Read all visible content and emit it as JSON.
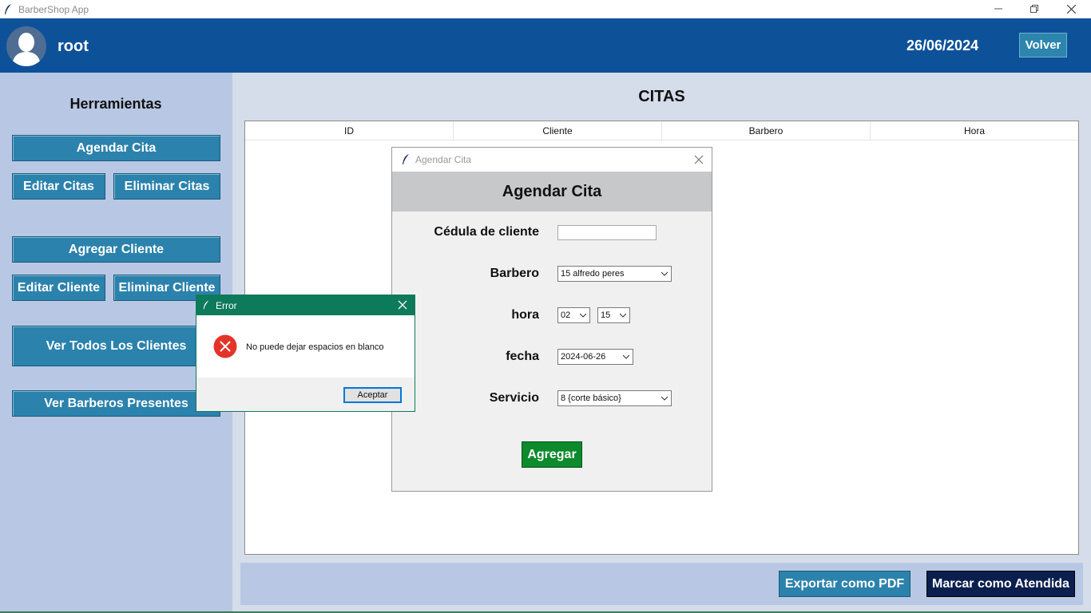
{
  "window": {
    "title": "BarberShop App"
  },
  "header": {
    "username": "root",
    "date": "26/06/2024",
    "back_label": "Volver"
  },
  "sidebar": {
    "title": "Herramientas",
    "buttons": {
      "agendar_cita": "Agendar Cita",
      "editar_citas": "Editar Citas",
      "eliminar_citas": "Eliminar Citas",
      "agregar_cliente": "Agregar Cliente",
      "editar_cliente": "Editar Cliente",
      "eliminar_cliente": "Eliminar Cliente",
      "ver_clientes": "Ver Todos Los Clientes",
      "ver_barberos": "Ver Barberos Presentes"
    }
  },
  "main": {
    "title": "CITAS",
    "columns": [
      "ID",
      "Cliente",
      "Barbero",
      "Hora"
    ]
  },
  "bottom": {
    "export_label": "Exportar como PDF",
    "mark_label": "Marcar como Atendida"
  },
  "agendar_dialog": {
    "window_title": "Agendar Cita",
    "heading": "Agendar Cita",
    "labels": {
      "cedula": "Cédula de cliente",
      "barbero": "Barbero",
      "hora": "hora",
      "fecha": "fecha",
      "servicio": "Servicio"
    },
    "values": {
      "cedula": "",
      "barbero": "15 alfredo peres",
      "hora_h": "02",
      "hora_m": "15",
      "fecha": "2024-06-26",
      "servicio": "8 {corte básico}"
    },
    "submit_label": "Agregar"
  },
  "error_dialog": {
    "title": "Error",
    "message": "No puede dejar espacios en blanco",
    "ok_label": "Aceptar"
  },
  "colors": {
    "header": "#0d5299",
    "sidebar": "#b8c8e4",
    "button": "#2b82ac",
    "agregar": "#0c8a2c",
    "mark": "#0b1f4f",
    "error_titlebar": "#0e7a5c",
    "error_icon": "#e3342a"
  },
  "icons": [
    "feather-icon",
    "minimize-icon",
    "restore-icon",
    "close-icon",
    "avatar-icon",
    "chevron-down-icon",
    "error-icon"
  ]
}
